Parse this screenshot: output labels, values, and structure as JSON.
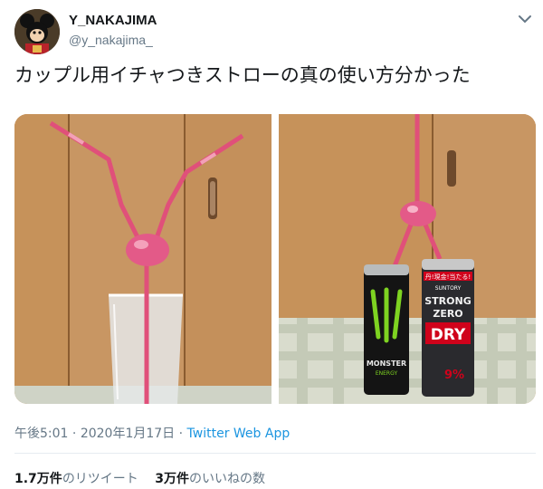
{
  "user": {
    "display_name": "Y_NAKAJIMA",
    "handle": "@y_nakajima_"
  },
  "tweet": {
    "text": "カップル用イチャつきストローの真の使い方分かった"
  },
  "photo_right": {
    "can1_brand": "MONSTER",
    "can1_sub": "ENERGY",
    "can2_banner": "丹!現金!当たる!",
    "can2_maker": "SUNTORY",
    "can2_line1": "STRONG",
    "can2_line2": "ZERO",
    "can2_line3": "DRY",
    "can2_abv": "9%"
  },
  "meta": {
    "time": "午後5:01",
    "sep1": " · ",
    "date": "2020年1月17日",
    "sep2": " · ",
    "app": "Twitter Web App"
  },
  "stats": {
    "retweets_count": "1.7万件",
    "retweets_label": "のリツイート",
    "likes_count": "3万件",
    "likes_label": "のいいねの数"
  },
  "colors": {
    "link": "#1b95e0",
    "muted": "#657786",
    "straw": "#e0507a"
  }
}
